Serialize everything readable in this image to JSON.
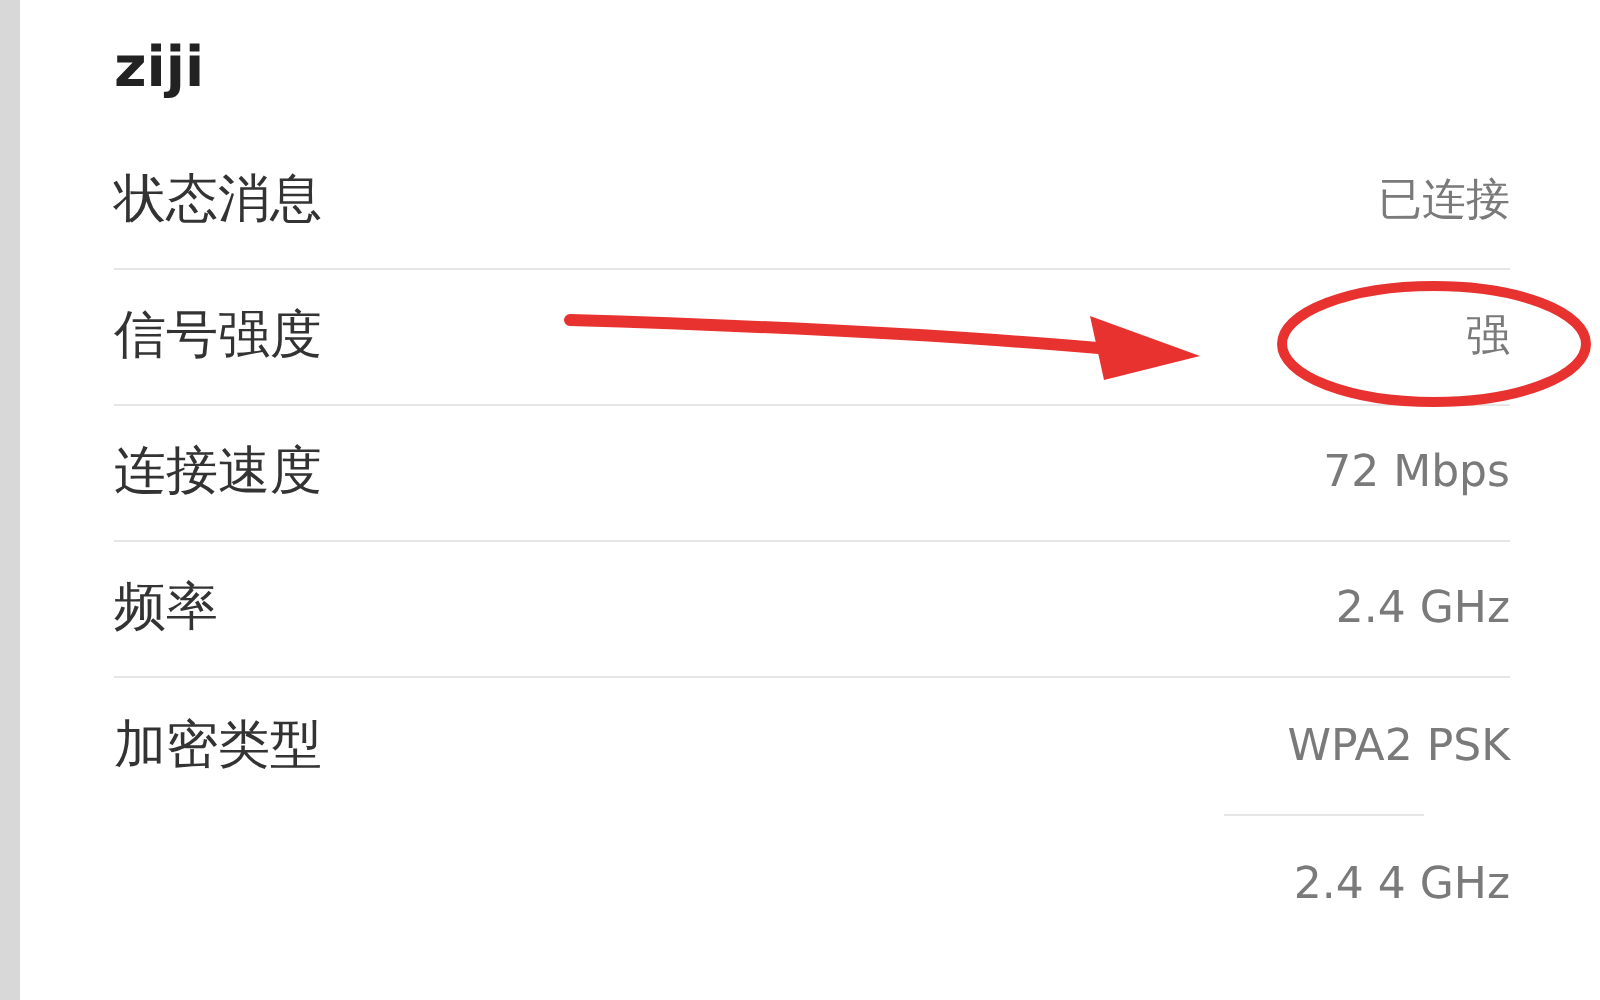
{
  "network_name": "ziji",
  "details": [
    {
      "label": "状态消息",
      "value": "已连接"
    },
    {
      "label": "信号强度",
      "value": "强"
    },
    {
      "label": "连接速度",
      "value": "72 Mbps"
    },
    {
      "label": "频率",
      "value": "2.4 GHz"
    },
    {
      "label": "加密类型",
      "value": "WPA2 PSK"
    }
  ],
  "partial_value": "2.4 4 GHz"
}
